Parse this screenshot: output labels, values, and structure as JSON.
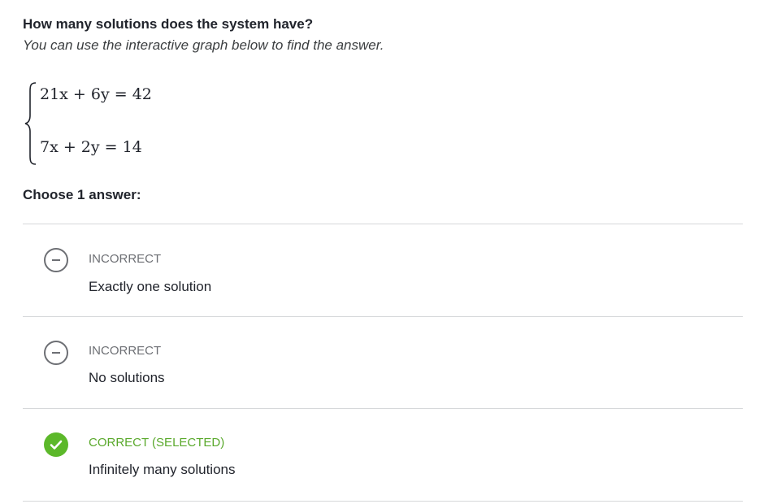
{
  "question": {
    "prompt": "How many solutions does the system have?",
    "hint": "You can use the interactive graph below to find the answer."
  },
  "system": {
    "equation_1": "21x + 6y = 42",
    "equation_2": "7x + 2y = 14"
  },
  "choose_label": "Choose 1 answer:",
  "choices": [
    {
      "status": "INCORRECT",
      "text": "Exactly one solution",
      "icon": "minus-circle-icon",
      "correct": false
    },
    {
      "status": "INCORRECT",
      "text": "No solutions",
      "icon": "minus-circle-icon",
      "correct": false
    },
    {
      "status": "CORRECT (SELECTED)",
      "text": "Infinitely many solutions",
      "icon": "checkmark-circle-icon",
      "correct": true,
      "selected": true
    }
  ],
  "colors": {
    "text": "#21242c",
    "incorrect": "#6d6f74",
    "correct_label": "#5aa92c",
    "correct_icon": "#5cb82a",
    "divider": "#d6d8da"
  }
}
